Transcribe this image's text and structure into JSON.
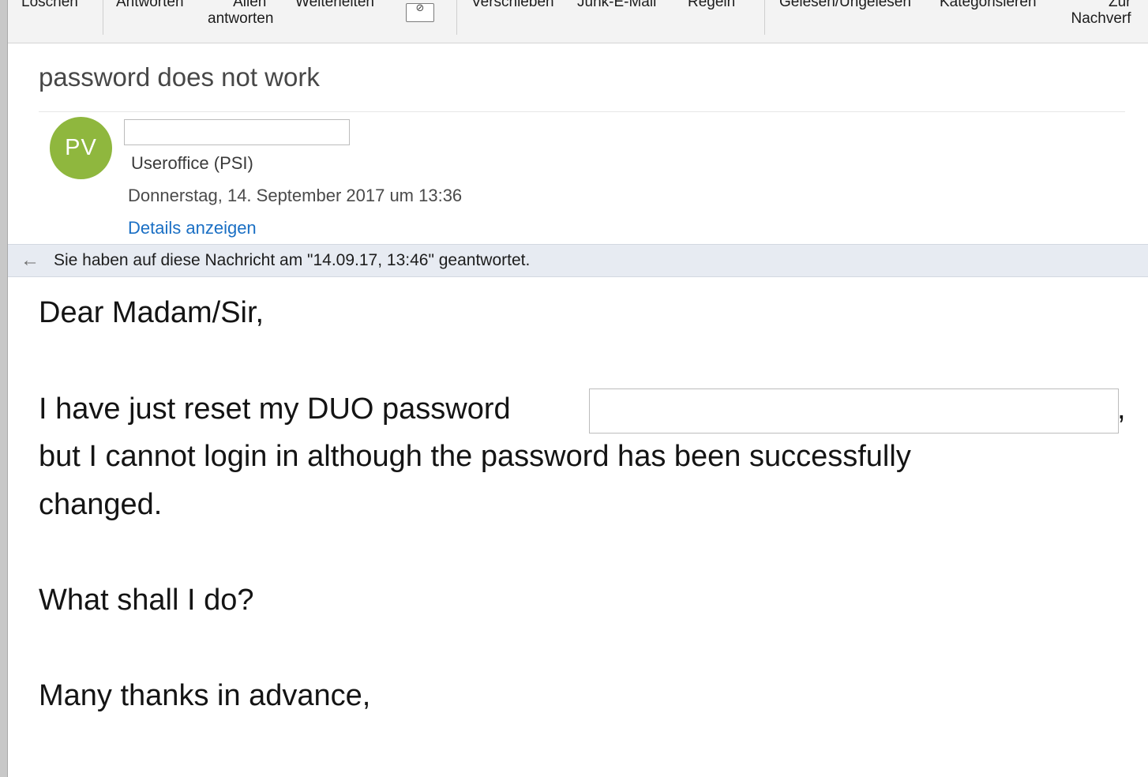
{
  "toolbar": {
    "items": [
      {
        "label": "Löschen"
      },
      {
        "label": "Antworten"
      },
      {
        "label_line1": "Allen",
        "label_line2": "antworten"
      },
      {
        "label": "Weiterleiten"
      },
      {
        "label": "Verschieben"
      },
      {
        "label": "Junk-E-Mail"
      },
      {
        "label": "Regeln"
      },
      {
        "label": "Gelesen/Ungelesen"
      },
      {
        "label": "Kategorisieren"
      },
      {
        "label_line1": "Zur",
        "label_line2": "Nachverf"
      }
    ]
  },
  "message": {
    "subject": "password does not work",
    "avatar_initials": "PV",
    "avatar_color": "#8fb73e",
    "recipient": "Useroffice (PSI)",
    "date": "Donnerstag, 14. September 2017 um 13:36",
    "details_link": "Details anzeigen",
    "info_bar": "Sie haben auf diese Nachricht am \"14.09.17, 13:46\" geantwortet.",
    "body": {
      "greeting": "Dear Madam/Sir,",
      "line1": "I have just reset my DUO password",
      "comma": ",",
      "line2": "but I cannot login in although the password has been successfully",
      "line3": "changed.",
      "question": "What shall I do?",
      "closing": "Many thanks in advance,"
    }
  },
  "colors": {
    "link": "#1a6fc4",
    "info_bar_bg": "#e7ebf2"
  }
}
